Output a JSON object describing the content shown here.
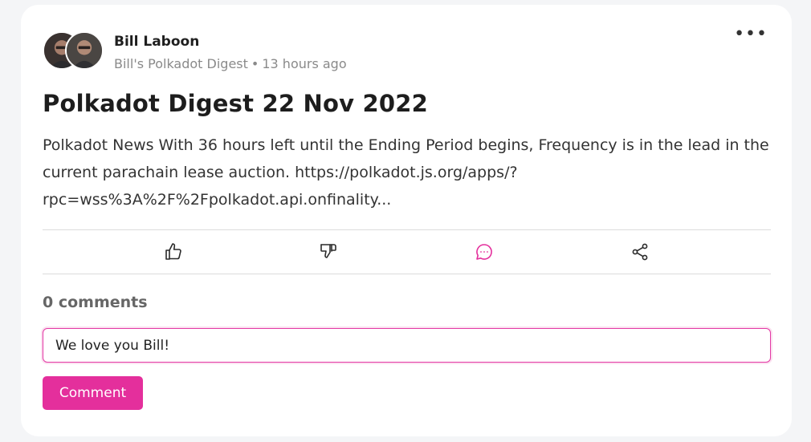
{
  "post": {
    "author": "Bill Laboon",
    "publication": "Bill's Polkadot Digest",
    "separator": "•",
    "time": "13 hours ago",
    "more_label": "•••",
    "title": "Polkadot Digest 22 Nov 2022",
    "body": "Polkadot News With 36 hours left until the Ending Period begins, Frequency is in the lead in the current parachain lease auction. https://polkadot.js.org/apps/?rpc=wss%3A%2F%2Fpolkadot.api.onfinality..."
  },
  "actions": [
    {
      "icon": "thumbs-up-icon",
      "active": false
    },
    {
      "icon": "thumbs-down-icon",
      "active": false
    },
    {
      "icon": "comment-icon",
      "active": true
    },
    {
      "icon": "share-icon",
      "active": false
    }
  ],
  "colors": {
    "accent": "#e42f9c",
    "muted": "#8a8a8a"
  },
  "comments": {
    "count_label": "0 comments",
    "input_value": "We love you Bill!",
    "submit_label": "Comment"
  }
}
